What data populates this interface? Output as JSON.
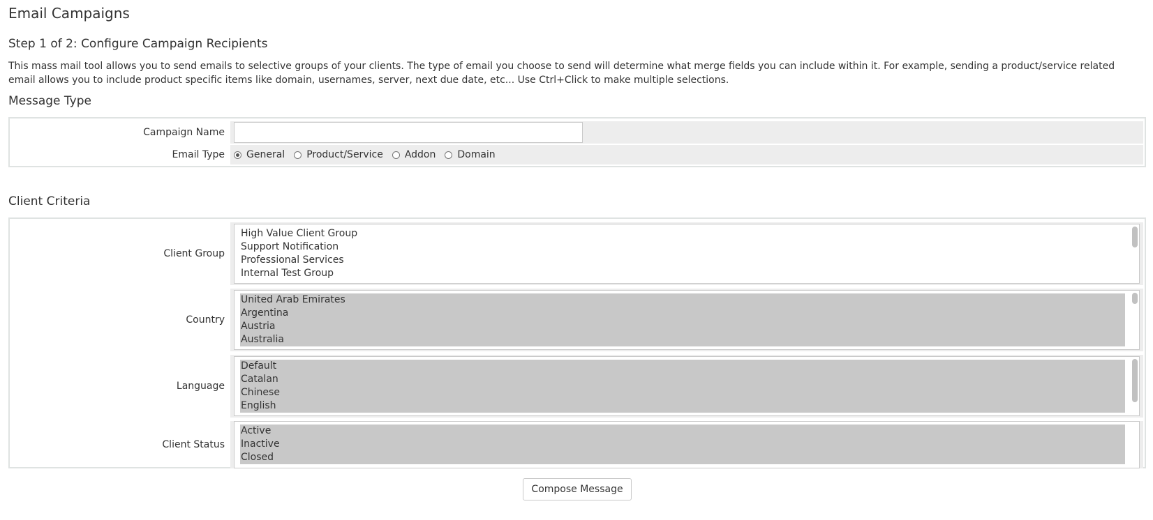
{
  "page_title": "Email Campaigns",
  "step_title": "Step 1 of 2: Configure Campaign Recipients",
  "description": "This mass mail tool allows you to send emails to selective groups of your clients. The type of email you choose to send will determine what merge fields you can include within it. For example, sending a product/service related email allows you to include product specific items like domain, usernames, server, next due date, etc... Use Ctrl+Click to make multiple selections.",
  "message_type": {
    "title": "Message Type",
    "campaign_name": {
      "label": "Campaign Name",
      "value": "",
      "placeholder": ""
    },
    "email_type": {
      "label": "Email Type",
      "options": [
        {
          "label": "General",
          "checked": true
        },
        {
          "label": "Product/Service",
          "checked": false
        },
        {
          "label": "Addon",
          "checked": false
        },
        {
          "label": "Domain",
          "checked": false
        }
      ]
    }
  },
  "client_criteria": {
    "title": "Client Criteria",
    "client_group": {
      "label": "Client Group",
      "items": [
        "High Value Client Group",
        "Support Notification",
        "Professional Services",
        "Internal Test Group"
      ]
    },
    "country": {
      "label": "Country",
      "items": [
        "United Arab Emirates",
        "Argentina",
        "Austria",
        "Australia"
      ]
    },
    "language": {
      "label": "Language",
      "items": [
        "Default",
        "Catalan",
        "Chinese",
        "English"
      ]
    },
    "client_status": {
      "label": "Client Status",
      "items": [
        "Active",
        "Inactive",
        "Closed"
      ]
    }
  },
  "actions": {
    "compose_label": "Compose Message"
  }
}
